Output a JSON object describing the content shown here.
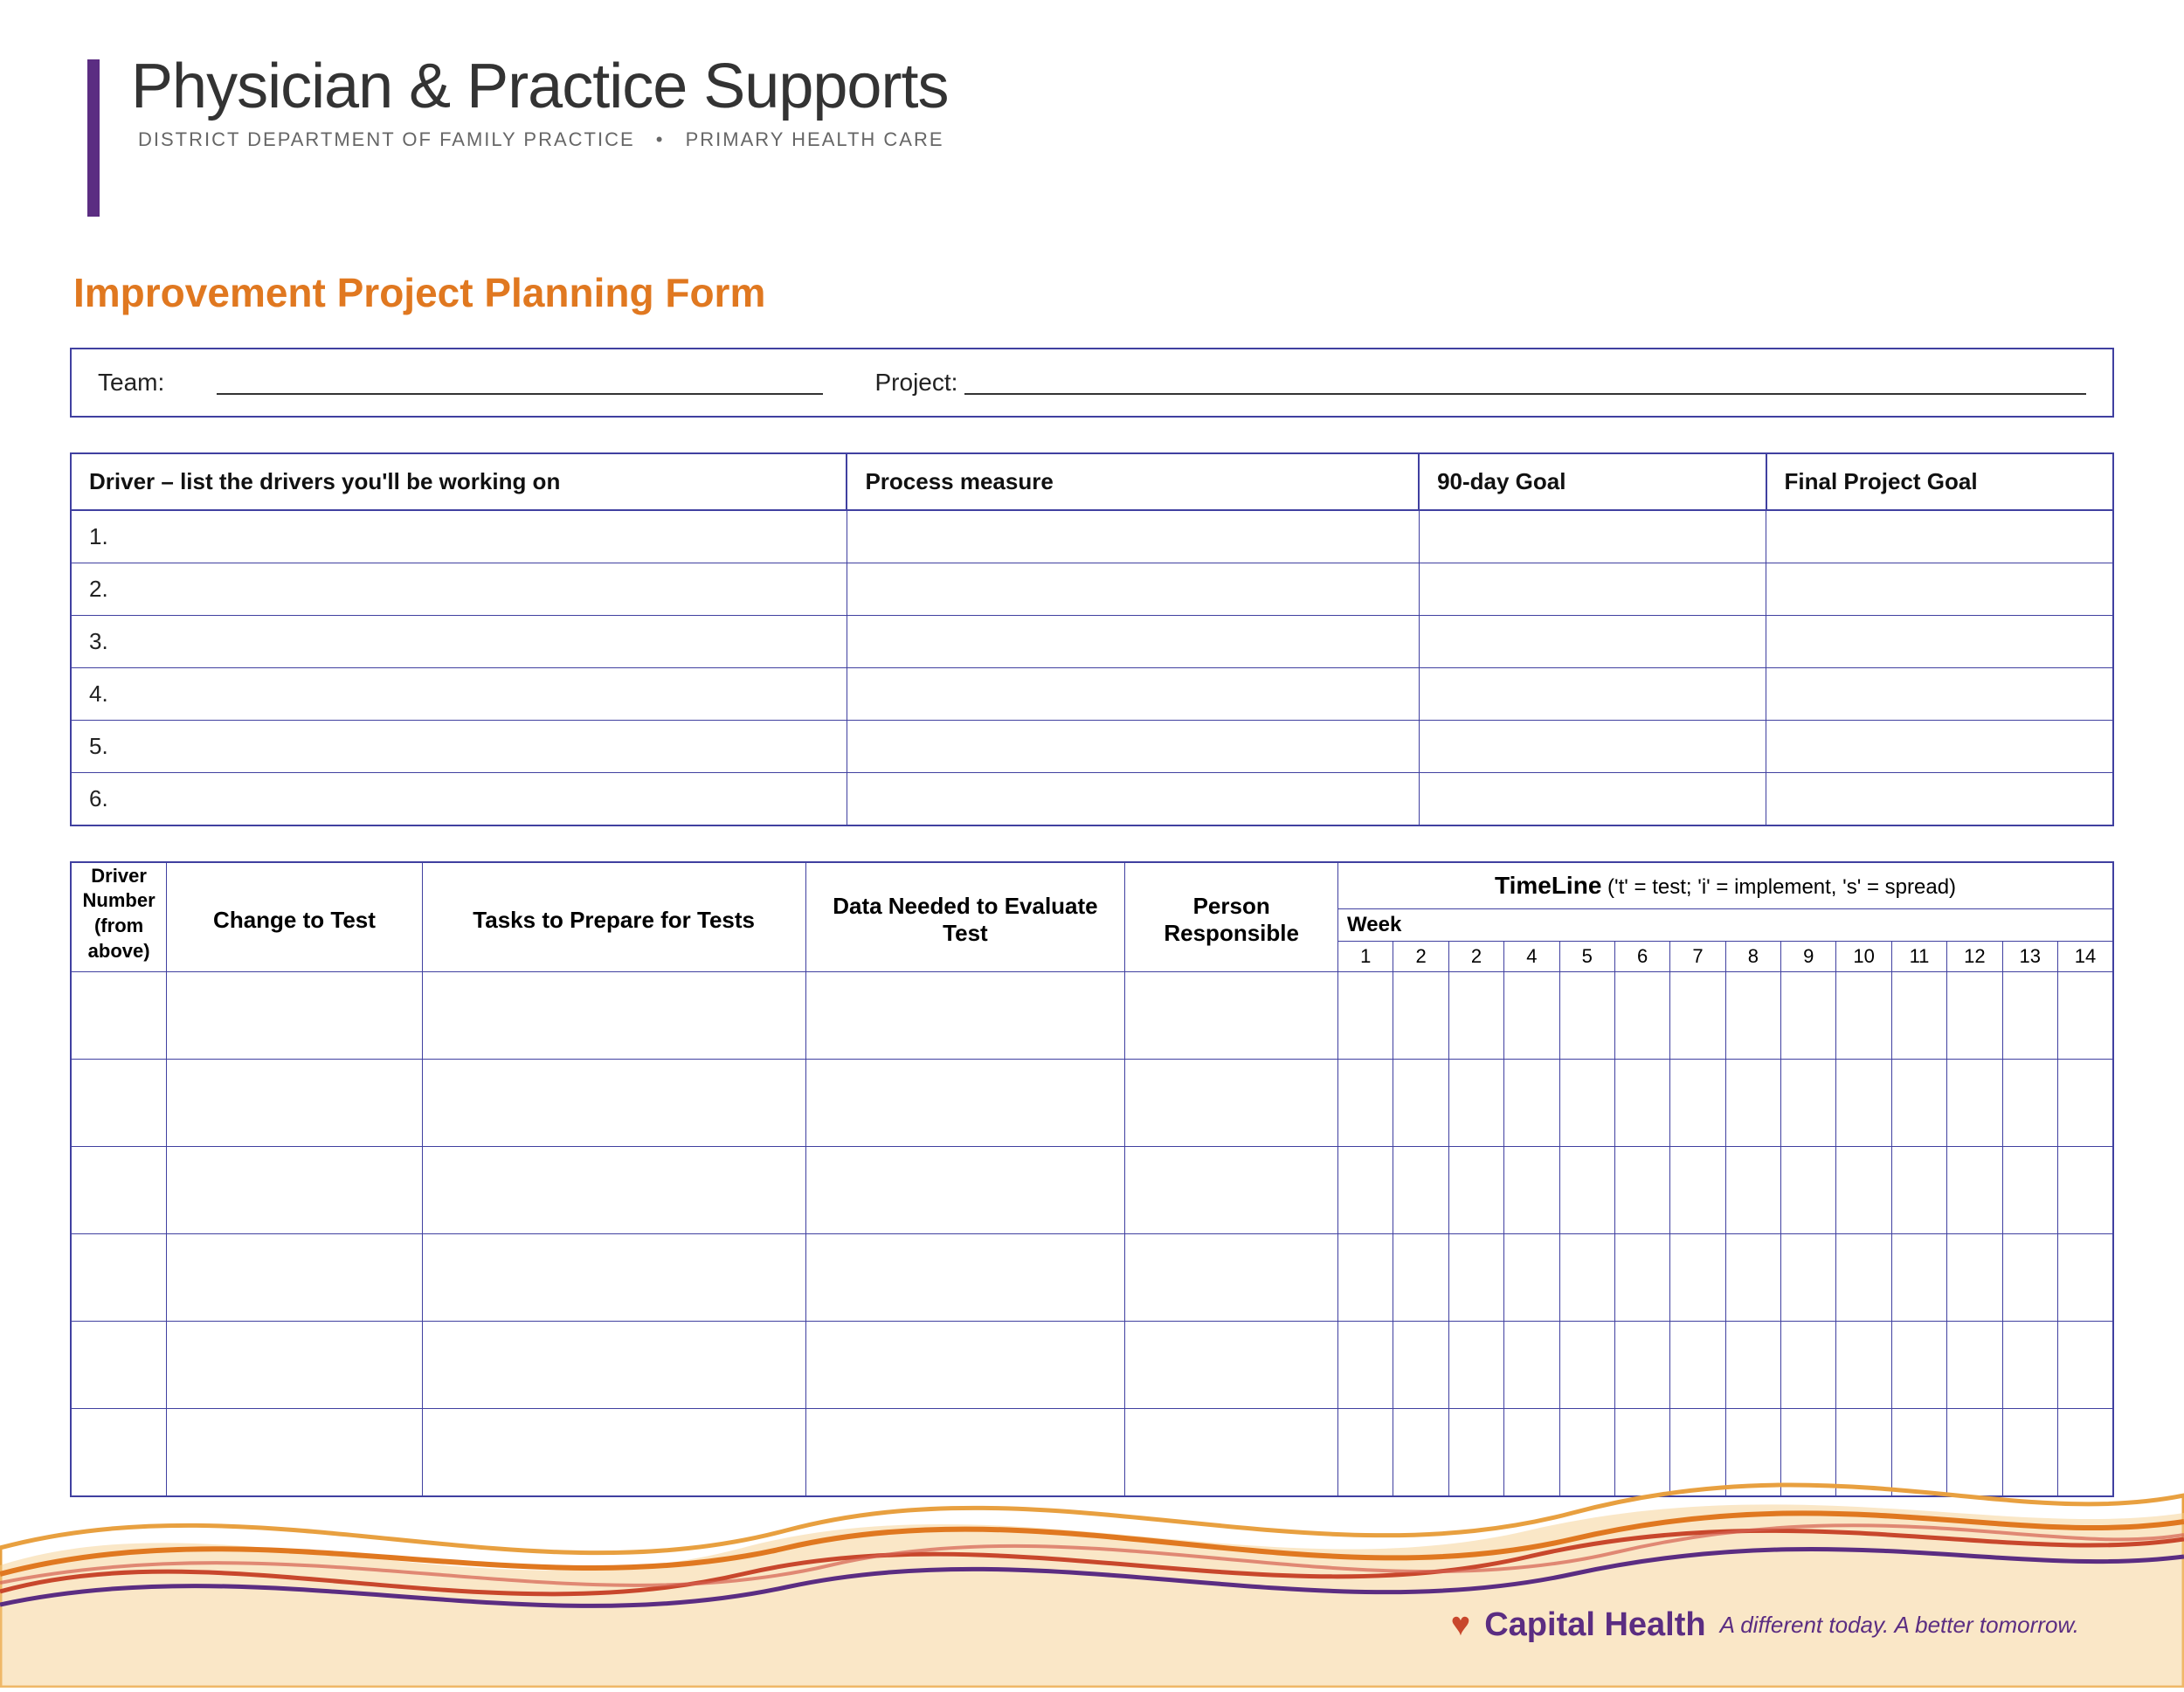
{
  "header": {
    "title": "Physician & Practice Supports",
    "subtitle_part1": "DISTRICT DEPARTMENT OF FAMILY PRACTICE",
    "subtitle_bullet": "•",
    "subtitle_part2": "PRIMARY HEALTH CARE"
  },
  "form": {
    "title": "Improvement Project Planning Form",
    "team_label": "Team:",
    "project_label": "Project:"
  },
  "driver_table": {
    "headers": [
      "Driver – list the drivers you'll be working on",
      "Process measure",
      "90-day Goal",
      "Final Project Goal"
    ],
    "rows": [
      "1.",
      "2.",
      "3.",
      "4.",
      "5.",
      "6."
    ]
  },
  "timeline_table": {
    "driver_num_header_line1": "Driver",
    "driver_num_header_line2": "Number",
    "driver_num_header_line3": "(from",
    "driver_num_header_line4": "above)",
    "change_header": "Change to Test",
    "tasks_header": "Tasks to Prepare for Tests",
    "data_needed_header": "Data Needed to Evaluate Test",
    "person_header": "Person Responsible",
    "timeline_header": "TimeLine",
    "timeline_note": " ('t' = test; 'i' = implement, 's' = spread)",
    "week_label": "Week",
    "week_numbers": [
      "1",
      "2",
      "2",
      "4",
      "5",
      "6",
      "7",
      "8",
      "9",
      "10",
      "11",
      "12",
      "13",
      "14"
    ],
    "data_rows": 6
  },
  "footer": {
    "capital_health": "Capital Health",
    "tagline": "A different today. A better tomorrow."
  }
}
